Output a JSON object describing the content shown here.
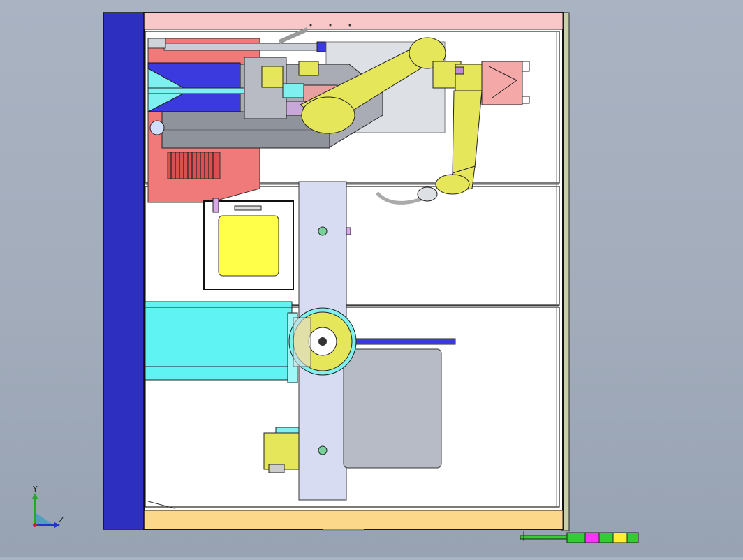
{
  "viewport": {
    "background": "#a6b0bf",
    "triad": {
      "y_label": "Y",
      "z_label": "Z"
    }
  },
  "colors": {
    "frame_blue": "#2d2fc0",
    "top_band": "#f8c8c8",
    "bottom_band": "#fcd98a",
    "robot_yellow": "#e6e65a",
    "cyan": "#5ff3f3",
    "lavender": "#d8dcf2",
    "window_yellow": "#ffff4a",
    "panel_gray": "#b7bbc5",
    "salmon": "#f07a7a",
    "beacon_green": "#33cc33",
    "beacon_magenta": "#ff33ff",
    "beacon_yellow": "#ffee33"
  },
  "model": {
    "type": "3D CAD assembly view - robotic welding / machining cell (top view)",
    "components": [
      "frame-left-rail",
      "enclosure-top-band",
      "enclosure-bottom-band",
      "six-axis-robot-arm",
      "robot-end-effector",
      "spindle-housing",
      "inspection-window",
      "rotary-table",
      "linear-conveyor",
      "cyan-guide-rail",
      "control-panel-gray",
      "stack-light-beacon"
    ]
  }
}
